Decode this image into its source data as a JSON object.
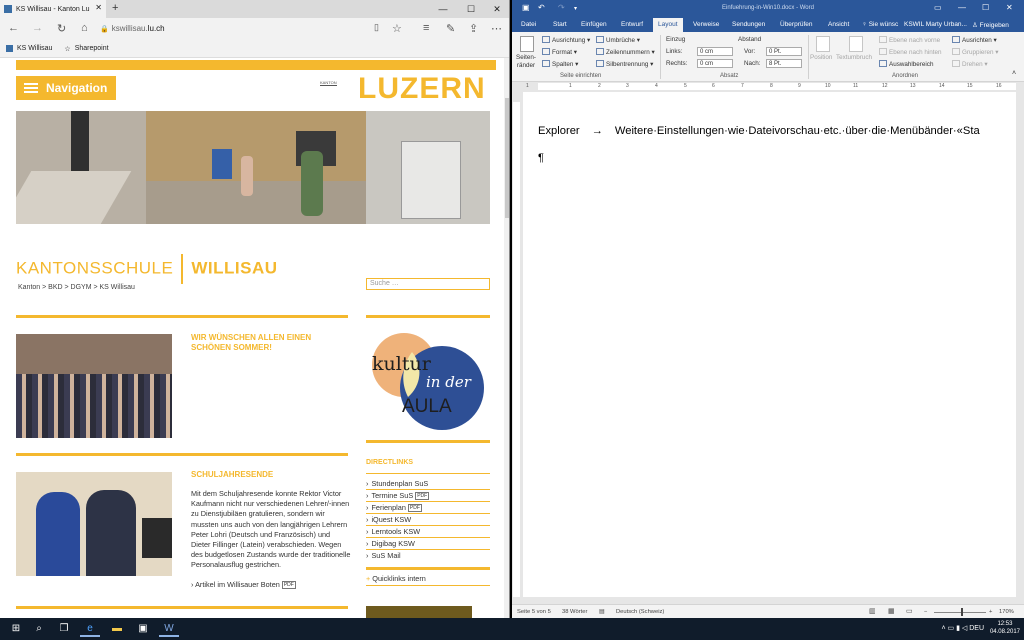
{
  "edge": {
    "tab_title": "KS Willisau - Kanton Lu",
    "tab_close": "✕",
    "new_tab": "+",
    "url_prefix": "kswillisau.",
    "url_domain": "lu.ch",
    "favorites": [
      "KS Willisau",
      "Sharepoint"
    ],
    "window_controls": [
      "—",
      "☐",
      "✕"
    ]
  },
  "webpage": {
    "nav_label": "Navigation",
    "brand": "LUZERN",
    "brand_small": "KANTON",
    "school_title_1": "KANTONSSCHULE",
    "school_title_2": "WILLISAU",
    "breadcrumb": "Kanton  >  BKD  >  DGYM  >  KS Willisau",
    "search_placeholder": "Suche …",
    "news": [
      {
        "title": "WIR WÜNSCHEN ALLEN EINEN SCHÖNEN SOMMER!"
      },
      {
        "title": "SCHULJAHRESENDE",
        "body": "Mit dem Schuljahresende konnte Rektor Victor Kaufmann nicht nur verschiedenen Lehrer/-innen zu Dienstjubiläen gratulieren, sondern wir mussten uns auch von den langjährigen Lehrern Peter Lohri (Deutsch und Französisch) und Dieter Fillinger (Latein) verabschieden. Wegen des budgetlosen Zustands wurde der traditionelle Personalausflug gestrichen.",
        "link": "Artikel im Willisauer Boten"
      }
    ],
    "kultur": {
      "line1": "kultur",
      "line2": "in der",
      "line3": "AULA"
    },
    "directlinks_title": "DIRECTLINKS",
    "directlinks": [
      "Stundenplan SuS",
      "Termine SuS",
      "Ferienplan",
      "iQuest KSW",
      "Lerntools KSW",
      "Digibag KSW",
      "SuS Mail"
    ],
    "pdf_label": "PDF",
    "quicklinks": "Quicklinks intern"
  },
  "word": {
    "title": "Einfuehrung-in-Win10.docx - Word",
    "tabs": [
      "Datei",
      "Start",
      "Einfügen",
      "Entwurf",
      "Layout",
      "Verweise",
      "Sendungen",
      "Überprüfen",
      "Ansicht"
    ],
    "active_tab": "Layout",
    "tell_me": "Sie wünsc",
    "user": "KSWIL Marty Urban...",
    "share": "Freigeben",
    "ribbon": {
      "seitenraender": "Seiten-\nränder",
      "ausrichtung": "Ausrichtung",
      "format": "Format",
      "spalten": "Spalten",
      "umbrueche": "Umbrüche",
      "zeilennummern": "Zeilennummern",
      "silbentrennung": "Silbentrennung",
      "group_seite": "Seite einrichten",
      "einzug": "Einzug",
      "abstand": "Abstand",
      "links": "Links:",
      "rechts": "Rechts:",
      "vor": "Vor:",
      "nach": "Nach:",
      "links_val": "0 cm",
      "rechts_val": "0 cm",
      "vor_val": "0 Pt.",
      "nach_val": "8 Pt.",
      "group_absatz": "Absatz",
      "position": "Position",
      "textumbruch": "Textumbruch",
      "ebene_vorne": "Ebene nach vorne",
      "ebene_hinten": "Ebene nach hinten",
      "auswahlbereich": "Auswahlbereich",
      "ausrichten": "Ausrichten",
      "gruppieren": "Gruppieren",
      "drehen": "Drehen",
      "group_anordnen": "Anordnen"
    },
    "ruler_numbers": [
      "1",
      "1",
      "2",
      "3",
      "4",
      "5",
      "6",
      "7",
      "8",
      "9",
      "10",
      "11",
      "12",
      "13",
      "14",
      "15",
      "16"
    ],
    "doc_line_left": "Explorer",
    "doc_line_arrow": "→",
    "doc_line_right": "Weitere·Einstellungen·wie·Dateivorschau·etc.·über·die·Menübänder·«Sta",
    "pilcrow": "¶",
    "status": {
      "page": "Seite 5 von 5",
      "words": "38 Wörter",
      "language": "Deutsch (Schweiz)",
      "zoom": "170%"
    }
  },
  "taskbar": {
    "language": "DEU",
    "time": "12:53",
    "date": "04.08.2017"
  }
}
